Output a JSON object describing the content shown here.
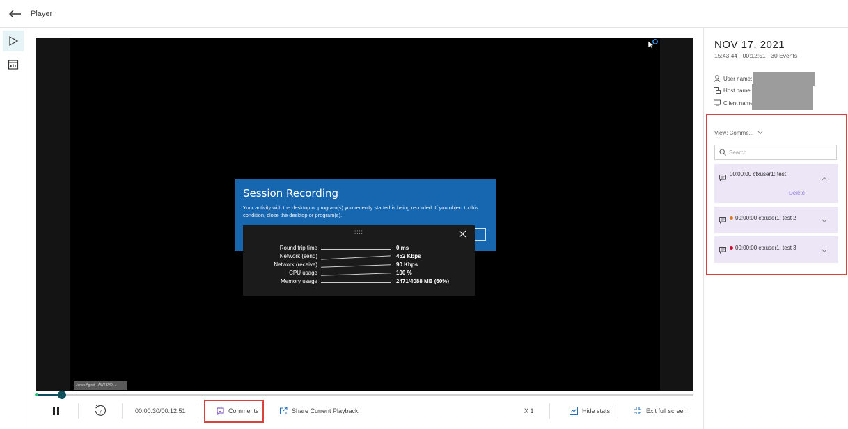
{
  "topbar": {
    "title": "Player"
  },
  "player": {
    "dialog": {
      "title": "Session Recording",
      "text": "Your activity with the desktop or program(s) you recently started is being recorded. If you object to this condition, close the desktop or program(s)."
    },
    "stats": {
      "grip": "::::",
      "rows": [
        {
          "label": "Round trip time",
          "value": "0 ms"
        },
        {
          "label": "Network (send)",
          "value": "452 Kbps"
        },
        {
          "label": "Network (receive)",
          "value": "90 Kbps"
        },
        {
          "label": "CPU usage",
          "value": "100 %"
        },
        {
          "label": "Memory usage",
          "value": "2471/4088 MB (60%)"
        }
      ]
    },
    "agent_tag": "Jenes Agent - AWTSVD..."
  },
  "timeline": {
    "progress": 0.039,
    "current": "00:00:30",
    "total": "00:12:51"
  },
  "controls": {
    "time": "00:00:30/00:12:51",
    "comments_label": "Comments",
    "share_label": "Share Current Playback",
    "speed_label": "X 1",
    "hide_stats_label": "Hide stats",
    "exit_label": "Exit full screen"
  },
  "sidebar": {
    "date": "NOV 17, 2021",
    "meta": "15:43:44 · 00:12:51 · 30 Events",
    "user_label": "User name:",
    "host_label": "Host name:",
    "client_label": "Client name",
    "view_label": "View:  Comme...",
    "search_placeholder": "Search",
    "comments": [
      {
        "text": "00:00:00 ctxuser1: test",
        "delete": "Delete",
        "dot": ""
      },
      {
        "text": "00:00:00 ctxuser1: test 2",
        "dot": "#e07b21"
      },
      {
        "text": "00:00:00 ctxuser1: test 3",
        "dot": "#c8102e"
      }
    ]
  },
  "colors": {
    "accent": "#0f4f5c",
    "highlight": "#d9423d",
    "comment_bg": "#ece6f7",
    "dialog_blue": "#1766b0"
  }
}
